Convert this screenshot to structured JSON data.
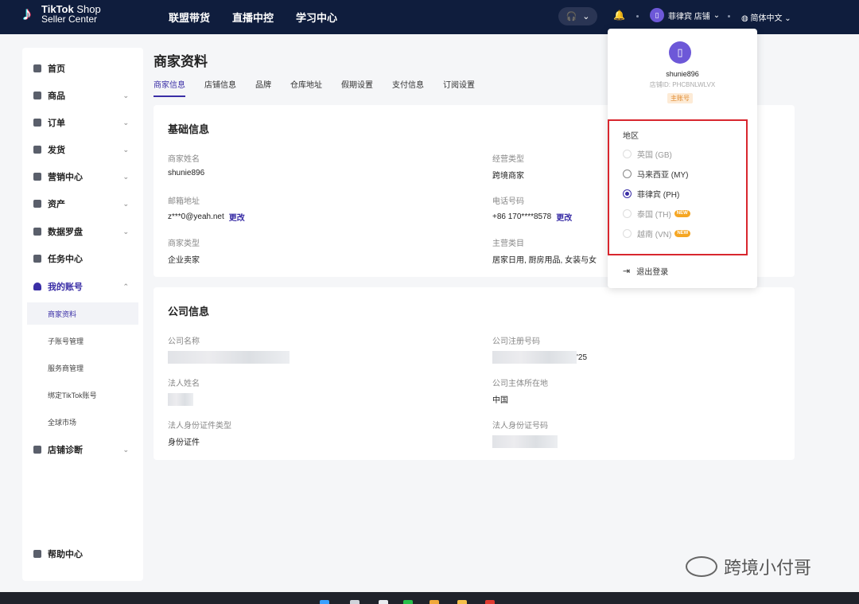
{
  "logo": {
    "brand": "TikTok",
    "brand2": "Shop",
    "sub": "Seller Center"
  },
  "topnav": [
    "联盟带货",
    "直播中控",
    "学习中心"
  ],
  "shop_label": "菲律宾 店铺",
  "language": "简体中文",
  "sidebar": {
    "items": [
      {
        "label": "首页",
        "icon": "home-icon"
      },
      {
        "label": "商品",
        "icon": "product-icon"
      },
      {
        "label": "订单",
        "icon": "order-icon"
      },
      {
        "label": "发货",
        "icon": "truck-icon"
      },
      {
        "label": "营销中心",
        "icon": "megaphone-icon"
      },
      {
        "label": "资产",
        "icon": "wallet-icon"
      },
      {
        "label": "数据罗盘",
        "icon": "chart-icon"
      },
      {
        "label": "任务中心",
        "icon": "medal-icon"
      },
      {
        "label": "我的账号",
        "icon": "user-icon"
      }
    ],
    "subitems": [
      "商家资料",
      "子账号管理",
      "服务商管理",
      "绑定TikTok账号",
      "全球市场"
    ],
    "diagnosis": "店铺诊断",
    "help": "帮助中心"
  },
  "page": {
    "title": "商家资料",
    "tabs": [
      "商家信息",
      "店铺信息",
      "品牌",
      "仓库地址",
      "假期设置",
      "支付信息",
      "订阅设置"
    ]
  },
  "basic": {
    "title": "基础信息",
    "merchant_name_label": "商家姓名",
    "merchant_name": "shunie896",
    "business_type_label": "经营类型",
    "business_type": "跨境商家",
    "email_label": "邮箱地址",
    "email": "z***0@yeah.net",
    "edit": "更改",
    "phone_label": "电话号码",
    "phone": "+86 170****8578",
    "merchant_type_label": "商家类型",
    "merchant_type": "企业卖家",
    "category_label": "主营类目",
    "category": "居家日用, 厨房用品, 女装与女"
  },
  "company": {
    "title": "公司信息",
    "name_label": "公司名称",
    "reg_label": "公司注册号码",
    "reg_suffix": "'25",
    "legal_label": "法人姓名",
    "location_label": "公司主体所在地",
    "location": "中国",
    "id_type_label": "法人身份证件类型",
    "id_type": "身份证件",
    "id_no_label": "法人身份证号码"
  },
  "popup": {
    "username": "shunie896",
    "shop_id": "店铺ID: PHCBNLWLVX",
    "role_badge": "主账号",
    "region_title": "地区",
    "regions": [
      {
        "label": "英国 (GB)",
        "state": "disabled",
        "new": ""
      },
      {
        "label": "马来西亚 (MY)",
        "state": "unchecked",
        "new": ""
      },
      {
        "label": "菲律宾 (PH)",
        "state": "checked",
        "new": ""
      },
      {
        "label": "泰国 (TH)",
        "state": "disabled",
        "new": "NEW"
      },
      {
        "label": "越南 (VN)",
        "state": "disabled",
        "new": "NEW"
      }
    ],
    "logout": "退出登录"
  },
  "watermark": "跨境小付哥",
  "colors": {
    "topbar": "#0f1d3d",
    "accent": "#3a2ea6",
    "highlight": "#d8262e"
  }
}
